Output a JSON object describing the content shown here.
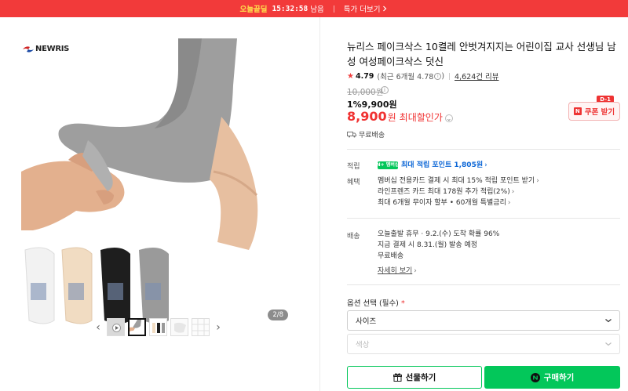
{
  "banner": {
    "brand": "오늘끝딜",
    "timer": "15:32:58",
    "timer_suffix": "남음",
    "more": "특가 더보기"
  },
  "gallery": {
    "logo_text": "NEWRIS",
    "counter": "2/8",
    "thumb_count": 5,
    "active_thumb": 2
  },
  "product": {
    "title": "뉴리스 페이크삭스 10켤레 안벗겨지지는 어린이집 교사 선생님 남성 여성페이크삭스 덧신",
    "rating": "4.79",
    "rating_recent": "(최근 6개월 4.78",
    "rating_recent_close": ")",
    "reviews": "4,624건 리뷰",
    "original_price": "10,000원",
    "discount_line": "1%9,900원",
    "price": "8,900",
    "price_unit": "원",
    "max_discount": "최대할인가",
    "coupon_tag": "D-1",
    "coupon_label": "쿠폰 받기",
    "shipping": "무료배송"
  },
  "benefits": {
    "points_label": "적립",
    "points_badge": "N+ 멤버십",
    "points_text": "최대 적립 포인트 1,805원",
    "benefit_label": "혜택",
    "benefit_lines": [
      "멤버십 전용카드 결제 시 최대 15% 적립 포인트 받기",
      "라인프렌즈 카드 최대 178원 추가 적립(2%)",
      "최대 6개월 무이자 할부 • 60개월 특별금리"
    ]
  },
  "delivery": {
    "label": "배송",
    "line1": "오늘출발 휴무 · 9.2.(수) 도착 확률 96%",
    "line2": "지금 결제 시 8.31.(월) 발송 예정",
    "line3": "무료배송",
    "detail": "자세히 보기"
  },
  "options": {
    "label": "옵션 선택 (필수)",
    "required_mark": "*",
    "size_placeholder": "사이즈",
    "color_placeholder": "색상"
  },
  "actions": {
    "gift": "선물하기",
    "buy": "구매하기"
  },
  "colors": {
    "banner": "#f23a3a",
    "price": "#f03232",
    "naver_green": "#03c75a"
  }
}
